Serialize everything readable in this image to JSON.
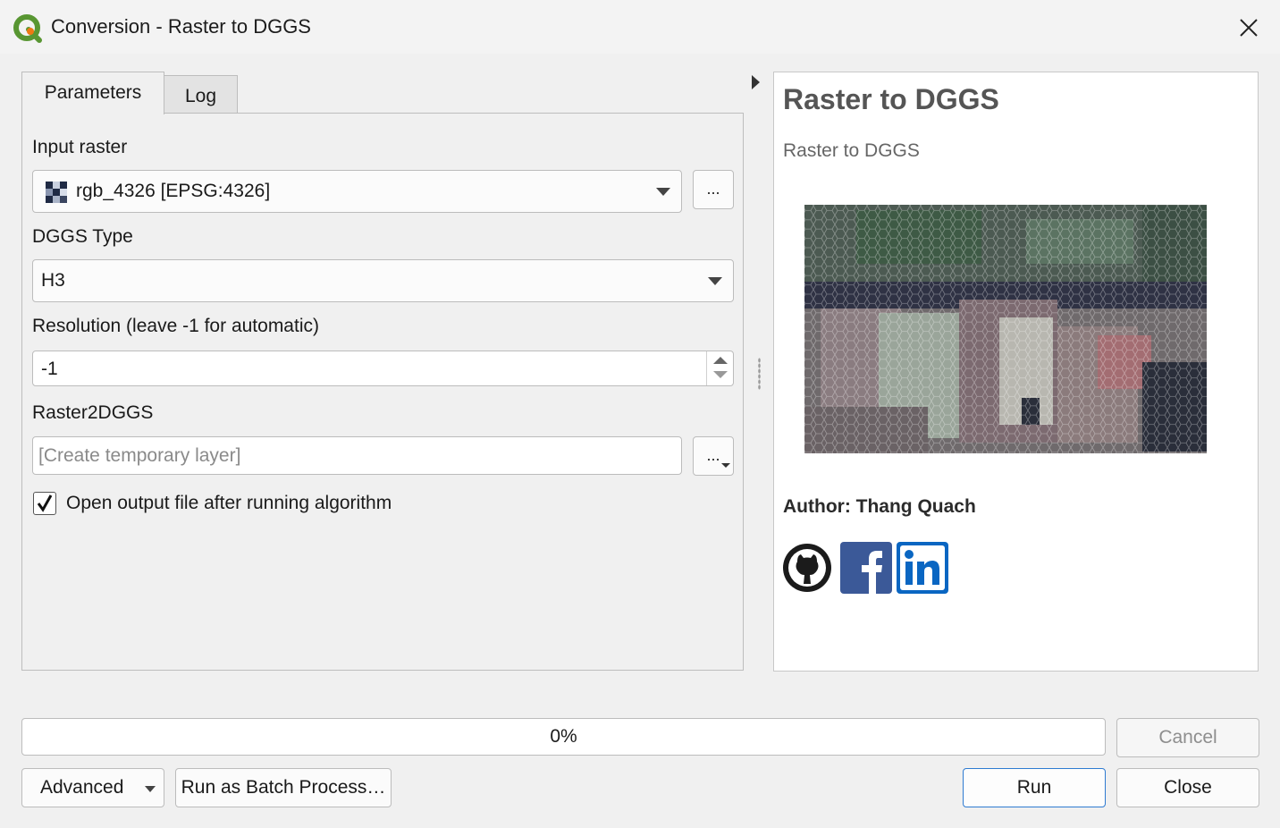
{
  "window": {
    "title": "Conversion - Raster to DGGS",
    "app_icon": "qgis-logo-icon",
    "close_icon": "close-icon"
  },
  "tabs": [
    {
      "label": "Parameters",
      "active": true
    },
    {
      "label": "Log",
      "active": false
    }
  ],
  "params": {
    "input_raster": {
      "label": "Input raster",
      "value": "rgb_4326 [EPSG:4326]",
      "icon": "raster-layer-icon",
      "browse_label": "..."
    },
    "dggs_type": {
      "label": "DGGS Type",
      "value": "H3"
    },
    "resolution": {
      "label": "Resolution (leave -1 for automatic)",
      "value": "-1"
    },
    "output": {
      "label": "Raster2DGGS",
      "placeholder": "[Create temporary layer]",
      "browse_label": "..."
    },
    "open_output": {
      "label": "Open output file after running algorithm",
      "checked": true
    }
  },
  "help": {
    "title": "Raster to DGGS",
    "description": "Raster to DGGS",
    "preview_image": "hexagon-dggs-raster-preview",
    "author": "Author: Thang Quach",
    "social_icons": [
      "github-icon",
      "facebook-icon",
      "linkedin-icon"
    ]
  },
  "progress": {
    "text": "0%",
    "value": 0
  },
  "buttons": {
    "cancel": "Cancel",
    "advanced": "Advanced",
    "batch": "Run as Batch Process…",
    "run": "Run",
    "close": "Close"
  },
  "colors": {
    "qgis_green": "#589632",
    "qgis_yellow": "#ee7913",
    "facebook_blue": "#3b5998",
    "linkedin_blue": "#0a66c2",
    "run_border": "#2f7bd1"
  }
}
